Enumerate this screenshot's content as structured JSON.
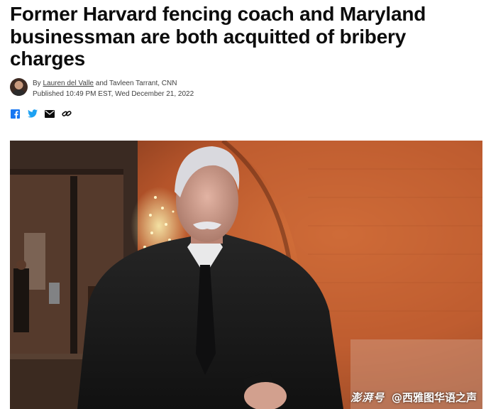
{
  "article": {
    "headline": "Former Harvard fencing coach and Maryland businessman are both acquitted of bribery charges",
    "byline": {
      "prefix": "By ",
      "author_link": "Lauren del Valle",
      "rest": " and Tavleen Tarrant, CNN",
      "published": "Published 10:49 PM EST, Wed December 21, 2022"
    }
  },
  "share": {
    "icons": [
      "facebook-icon",
      "twitter-icon",
      "email-icon",
      "link-icon"
    ],
    "brand_colors": {
      "facebook": "#1877f2",
      "twitter": "#1da1f2",
      "email": "#0c0c0c",
      "link": "#0c0c0c"
    }
  },
  "photo": {
    "watermark_logo": "澎湃号",
    "watermark_text": "@西雅图华语之声"
  },
  "colors": {
    "headline": "#0c0c0c",
    "meta": "#404040",
    "photo_wall": "#b5542a"
  }
}
